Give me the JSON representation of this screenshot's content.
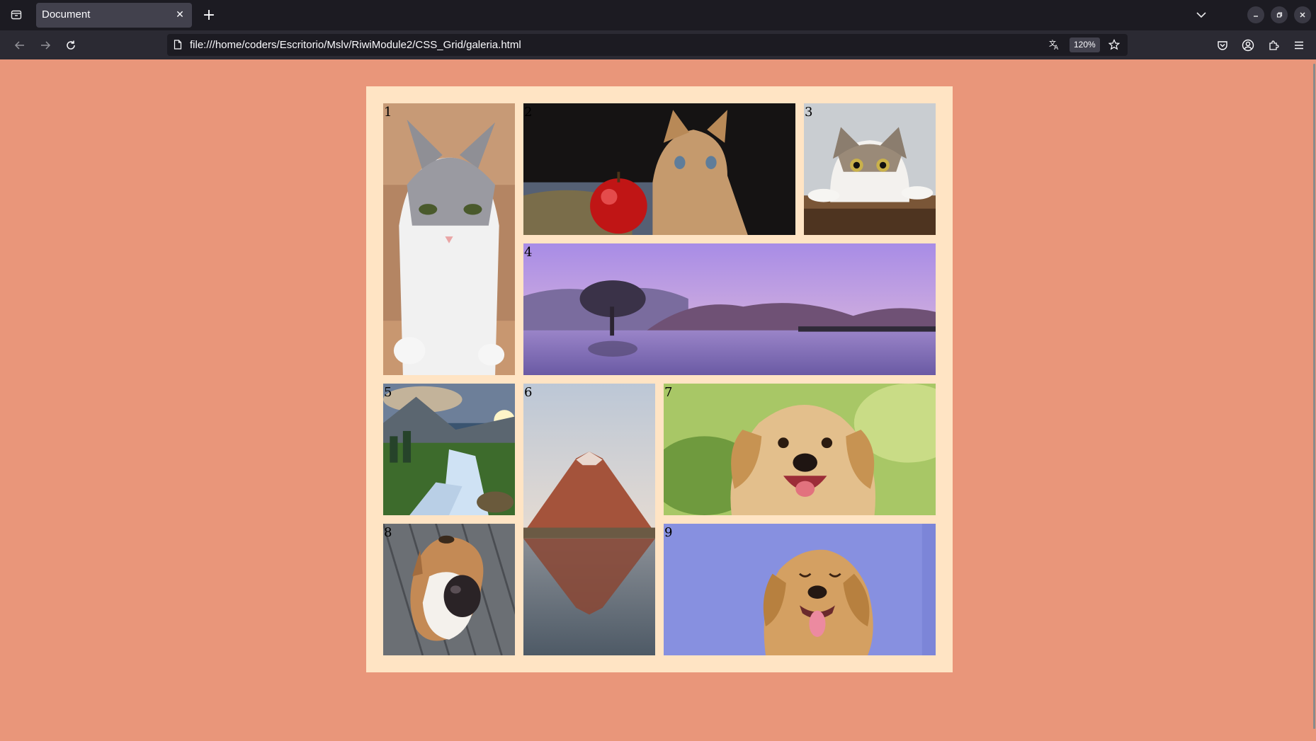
{
  "browser": {
    "tab": {
      "title": "Document"
    },
    "address_bar": {
      "url": "file:///home/coders/Escritorio/Mslv/RiwiModule2/CSS_Grid/galeria.html",
      "zoom": "120%"
    }
  },
  "colors": {
    "page_background": "#e9967a",
    "gallery_background": "#ffe4c4"
  },
  "gallery": {
    "items": [
      {
        "number": "1",
        "subject": "grey and white cat on wooden table"
      },
      {
        "number": "2",
        "subject": "kitten with red apple"
      },
      {
        "number": "3",
        "subject": "surprised cat peeking over box"
      },
      {
        "number": "4",
        "subject": "lone tree in lake at purple dusk"
      },
      {
        "number": "5",
        "subject": "mountain waterfall at sunrise"
      },
      {
        "number": "6",
        "subject": "volcano reflected in lake"
      },
      {
        "number": "7",
        "subject": "smiling golden retriever"
      },
      {
        "number": "8",
        "subject": "dog nose close-up on wooden deck"
      },
      {
        "number": "9",
        "subject": "golden retriever on blue background"
      }
    ]
  }
}
